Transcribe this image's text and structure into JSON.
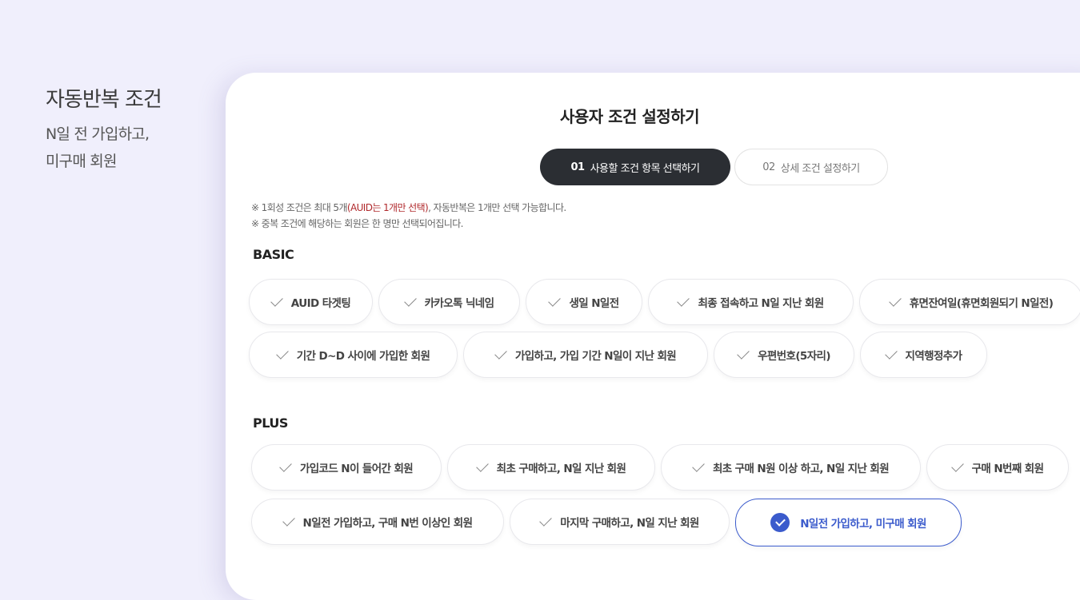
{
  "sidebar": {
    "title": "자동반복 조건",
    "desc_line1": "N일 전 가입하고,",
    "desc_line2": "미구매 회원"
  },
  "modal": {
    "title": "사용자 조건 설정하기",
    "steps": [
      {
        "num": "01",
        "label": "사용할 조건 항목 선택하기",
        "active": true
      },
      {
        "num": "02",
        "label": "상세 조건 설정하기",
        "active": false
      }
    ],
    "notice": {
      "line1_pre": "※ 1회성 조건은 최대 5개",
      "line1_red": "(AUID는 1개만 선택)",
      "line1_post": ", 자동반복은 1개만 선택 가능합니다.",
      "line2": "※ 중복 조건에 해당하는 회원은 한 명만 선택되어집니다."
    }
  },
  "basic": {
    "label": "BASIC",
    "items": [
      "AUID 타겟팅",
      "카카오톡 닉네임",
      "생일 N일전",
      "최종 접속하고 N일 지난 회원",
      "휴면잔여일(휴면회원되기 N일전)",
      "기간 D~D 사이에 가입한 회원",
      "가입하고, 가입 기간 N일이 지난 회원",
      "우편번호(5자리)",
      "지역행정추가"
    ]
  },
  "plus": {
    "label": "PLUS",
    "items": [
      "가입코드 N이 들어간 회원",
      "최초 구매하고, N일 지난 회원",
      "최초 구매 N원 이상 하고, N일 지난 회원",
      "구매 N번째 회원",
      "N일전 가입하고, 구매 N번 이상인 회원",
      "마지막 구매하고, N일 지난 회원",
      "N일전 가입하고, 미구매 회원"
    ],
    "selected_item": "N일전 가입하고, 미구매 회원"
  },
  "colors": {
    "page_bg": "#f0effc",
    "active_step": "#2b2e33",
    "selected_accent": "#3b5bcc",
    "notice_red": "#b0292c"
  }
}
